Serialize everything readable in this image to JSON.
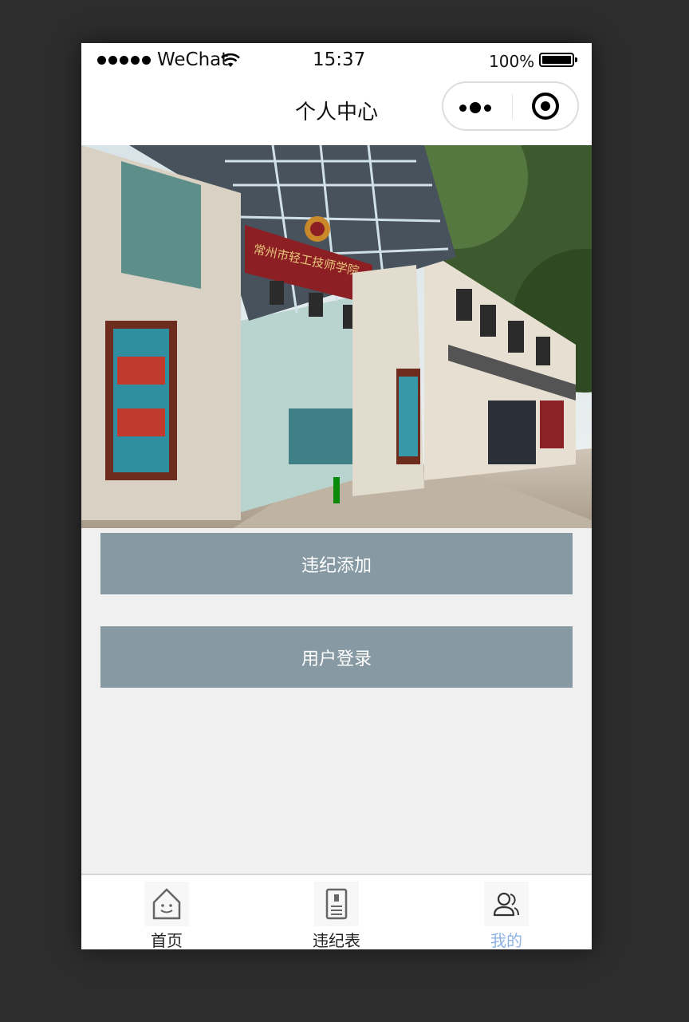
{
  "status_bar": {
    "carrier": "WeChat",
    "time": "15:37",
    "battery": "100%"
  },
  "nav": {
    "title": "个人中心"
  },
  "banner": {
    "sign_text": "常州市轻工技师学院",
    "icon": "campus-gate-photo"
  },
  "actions": [
    {
      "label": "违纪添加"
    },
    {
      "label": "用户登录"
    }
  ],
  "tabbar": {
    "items": [
      {
        "label": "首页",
        "icon": "home-icon",
        "active": false
      },
      {
        "label": "违纪表",
        "icon": "document-icon",
        "active": false
      },
      {
        "label": "我的",
        "icon": "user-icon",
        "active": true
      }
    ],
    "active_color": "#8fb2e6"
  },
  "colors": {
    "button": "#8799a3",
    "page_bg": "#f0f0f0",
    "indicator": "#0a8a0a"
  }
}
